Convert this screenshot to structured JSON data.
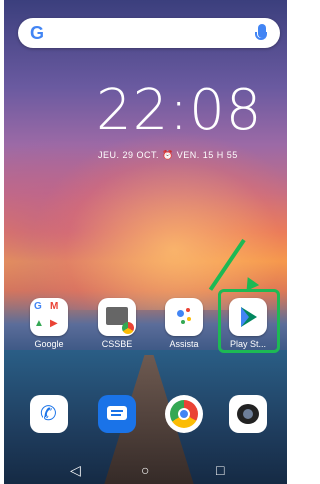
{
  "search": {
    "google_glyph": "G"
  },
  "lockscreen": {
    "time": "22:08",
    "date_alarm": "JEU. 29 OCT. ⏰ VEN. 15 H 55"
  },
  "apps": [
    {
      "label": "Google",
      "icon": "google-folder-icon"
    },
    {
      "label": "CSSBE",
      "icon": "cssbe-icon"
    },
    {
      "label": "Assista",
      "icon": "assistant-icon"
    },
    {
      "label": "Play St...",
      "icon": "play-store-icon"
    }
  ],
  "dock": [
    {
      "icon": "phone-icon"
    },
    {
      "icon": "messages-icon"
    },
    {
      "icon": "chrome-icon"
    },
    {
      "icon": "camera-icon"
    }
  ],
  "nav": {
    "back": "◁",
    "home": "○",
    "recents": "□"
  },
  "colors": {
    "highlight": "#1db954"
  }
}
